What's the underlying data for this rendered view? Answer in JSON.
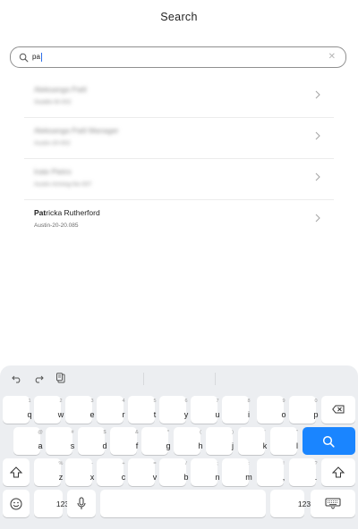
{
  "header": {
    "title": "Search"
  },
  "search": {
    "value": "pa"
  },
  "results": [
    {
      "name": "Aleksanga Patil",
      "sub": "Seattle-W-002",
      "blurred": true
    },
    {
      "name": "Aleksanga Patil Manager",
      "sub": "Austin-20-002",
      "blurred": true
    },
    {
      "name": "Irate Pietro",
      "sub": "Austin-Arming-No-007",
      "blurred": true
    },
    {
      "name_bold": "Pat",
      "name_rest": "ricka Rutherford",
      "sub": "Austin-20-20.085",
      "blurred": false
    }
  ],
  "keyboard": {
    "row1": [
      {
        "main": "q",
        "hint": "1"
      },
      {
        "main": "w",
        "hint": "2"
      },
      {
        "main": "e",
        "hint": "3"
      },
      {
        "main": "r",
        "hint": "4"
      },
      {
        "main": "t",
        "hint": "5"
      },
      {
        "main": "y",
        "hint": "6"
      },
      {
        "main": "u",
        "hint": "7"
      },
      {
        "main": "i",
        "hint": "8"
      },
      {
        "main": "o",
        "hint": "9"
      },
      {
        "main": "p",
        "hint": "0"
      }
    ],
    "row2": [
      {
        "main": "a",
        "hint": "@"
      },
      {
        "main": "s",
        "hint": "#"
      },
      {
        "main": "d",
        "hint": "$"
      },
      {
        "main": "f",
        "hint": "&"
      },
      {
        "main": "g",
        "hint": "*"
      },
      {
        "main": "h",
        "hint": "("
      },
      {
        "main": "j",
        "hint": ")"
      },
      {
        "main": "k",
        "hint": "'"
      },
      {
        "main": "l",
        "hint": "\""
      }
    ],
    "row3": [
      {
        "main": "z",
        "hint": "%"
      },
      {
        "main": "x",
        "hint": "-"
      },
      {
        "main": "c",
        "hint": "+"
      },
      {
        "main": "v",
        "hint": "="
      },
      {
        "main": "b",
        "hint": "/"
      },
      {
        "main": "n",
        "hint": ";"
      },
      {
        "main": "m",
        "hint": ":"
      },
      {
        "main": ",",
        "hint": "!"
      },
      {
        "main": ".",
        "hint": "?"
      }
    ],
    "numbers_label": "123",
    "numbers_label_right": "123"
  },
  "colors": {
    "accent": "#1a85ff",
    "keyboard_bg": "#eceef1",
    "border": "#8f8f8f"
  },
  "icons": [
    "search-icon",
    "clear-icon",
    "chevron-right-icon",
    "undo-icon",
    "redo-icon",
    "clipboard-icon",
    "delete-icon",
    "shift-icon",
    "emoji-icon",
    "microphone-icon",
    "keyboard-hide-icon"
  ]
}
